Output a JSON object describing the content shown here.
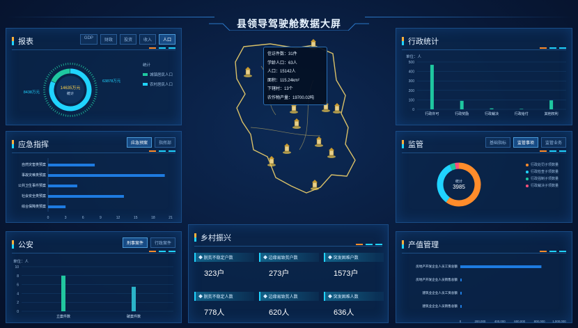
{
  "header": {
    "title": "县领导驾驶舱数据大屏"
  },
  "colors": {
    "accent": "#20d3ff",
    "orange": "#ff8c2b",
    "green": "#1fc7a0",
    "panel": "#0a264c"
  },
  "report": {
    "title": "报表",
    "tabs": [
      "GDP",
      "财政",
      "投资",
      "收入",
      "人口"
    ],
    "active_tab": "人口",
    "donut": {
      "center_value": "14635万元",
      "center_label": "统计",
      "left_label": "8438万元",
      "right_label": "63878万元"
    },
    "legend_title": "统计",
    "legend": [
      {
        "label": "城镇居民人口",
        "color": "#1fc7a0"
      },
      {
        "label": "农村居民人口",
        "color": "#20d3ff"
      }
    ]
  },
  "emergency": {
    "title": "应急指挥",
    "tabs": [
      "应急预案",
      "指挥部"
    ],
    "active_tab": "应急预案"
  },
  "police": {
    "title": "公安",
    "tabs": [
      "刑事案件",
      "行政案件"
    ],
    "active_tab": "刑事案件",
    "unit": "单位：人"
  },
  "map": {
    "tooltip": [
      {
        "label": "信访件数",
        "value": "31件"
      },
      {
        "label": "学龄人口",
        "value": "63人"
      },
      {
        "label": "人口",
        "value": "15142人"
      },
      {
        "label": "面积",
        "value": "115.24km²"
      },
      {
        "label": "下辖村",
        "value": "13个"
      },
      {
        "label": "农作物产量",
        "value": "19700.02吨"
      }
    ]
  },
  "rural": {
    "title": "乡村振兴",
    "cards": [
      {
        "label": "脱贫不稳定户数",
        "value": "323户"
      },
      {
        "label": "边缘易致贫户数",
        "value": "273户"
      },
      {
        "label": "突发困难户数",
        "value": "1573户"
      },
      {
        "label": "脱贫不稳定人数",
        "value": "778人"
      },
      {
        "label": "边缘易致贫人数",
        "value": "620人"
      },
      {
        "label": "突发困难人数",
        "value": "636人"
      }
    ]
  },
  "admin": {
    "title": "行政统计",
    "unit": "单位：人"
  },
  "supervision": {
    "title": "监管",
    "tabs": [
      "基础指标",
      "监管事项",
      "监管业务"
    ],
    "active_tab": "监管事项",
    "donut": {
      "center_label": "统计",
      "center_value": "3985"
    },
    "legend": [
      {
        "label": "行政处罚子项数量",
        "color": "#ff8c2b"
      },
      {
        "label": "行政检查子项数量",
        "color": "#20d3ff"
      },
      {
        "label": "行政强制子项数量",
        "color": "#1fc7a0"
      },
      {
        "label": "行政裁决子项数量",
        "color": "#ff4f7a"
      }
    ]
  },
  "property": {
    "title": "产值管理"
  },
  "chart_data": [
    {
      "type": "bar",
      "id": "emergency",
      "orientation": "horizontal",
      "categories": [
        "自然灾害类预案",
        "事故灾难类预案",
        "公共卫生事件预案",
        "社会安全类预案",
        "综合保障类预案"
      ],
      "values": [
        8,
        20,
        5,
        13,
        3
      ],
      "xlim": [
        0,
        21
      ],
      "xticks": [
        0,
        3,
        6,
        9,
        12,
        15,
        18,
        21
      ]
    },
    {
      "type": "bar",
      "id": "police",
      "categories": [
        "立案件数",
        "破案件数"
      ],
      "values": [
        8,
        5.5
      ],
      "ylim": [
        0,
        10
      ],
      "yticks": [
        0,
        2,
        4,
        6,
        8,
        10
      ]
    },
    {
      "type": "bar",
      "id": "admin",
      "categories": [
        "行政许可",
        "行政奖励",
        "行政裁决",
        "行政给付",
        "其他权利"
      ],
      "values": [
        470,
        90,
        10,
        5,
        95
      ],
      "ylim": [
        0,
        500
      ],
      "yticks": [
        0,
        100,
        200,
        300,
        400,
        500
      ]
    },
    {
      "type": "pie",
      "id": "supervision",
      "values": [
        60,
        33,
        4,
        3
      ]
    },
    {
      "type": "bar",
      "id": "property",
      "orientation": "horizontal",
      "categories": [
        "房地产开发企业人员工资总额",
        "房地产开发企业人员销售总额",
        "建筑业企业人员工资总额",
        "建筑业企业人员销售总额"
      ],
      "values": [
        820000,
        12000,
        7000,
        6000
      ],
      "xlim": [
        0,
        1000000
      ],
      "xticks": [
        "0",
        "200,000",
        "400,000",
        "600,000",
        "800,000",
        "1,000,000"
      ]
    },
    {
      "type": "pie",
      "id": "report",
      "values": [
        82,
        18
      ]
    }
  ]
}
